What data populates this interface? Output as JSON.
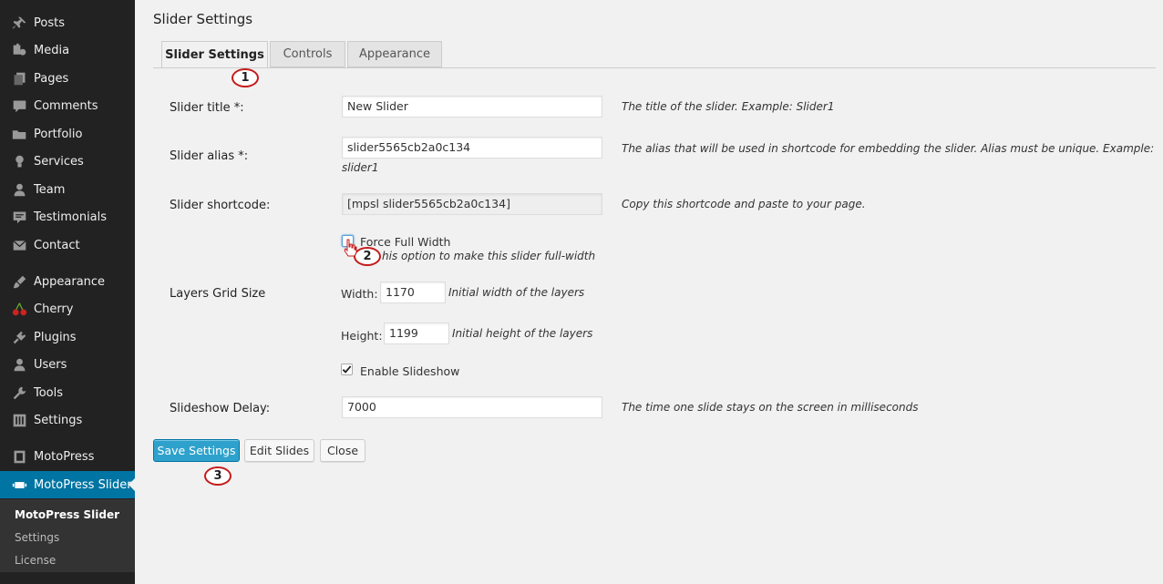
{
  "sidebar": {
    "items": [
      {
        "label": "Posts",
        "icon": "pin-icon"
      },
      {
        "label": "Media",
        "icon": "media-icon"
      },
      {
        "label": "Pages",
        "icon": "pages-icon"
      },
      {
        "label": "Comments",
        "icon": "comment-icon"
      },
      {
        "label": "Portfolio",
        "icon": "folder-icon"
      },
      {
        "label": "Services",
        "icon": "lightbulb-icon"
      },
      {
        "label": "Team",
        "icon": "person-icon"
      },
      {
        "label": "Testimonials",
        "icon": "testimonial-icon"
      },
      {
        "label": "Contact",
        "icon": "envelope-icon"
      },
      {
        "label": "Appearance",
        "icon": "paintbrush-icon"
      },
      {
        "label": "Cherry",
        "icon": "cherry-icon"
      },
      {
        "label": "Plugins",
        "icon": "plug-icon"
      },
      {
        "label": "Users",
        "icon": "users-icon"
      },
      {
        "label": "Tools",
        "icon": "wrench-icon"
      },
      {
        "label": "Settings",
        "icon": "settings-icon"
      },
      {
        "label": "MotoPress",
        "icon": "motopress-icon"
      },
      {
        "label": "MotoPress Slider",
        "icon": "slider-icon"
      }
    ],
    "submenu": [
      "MotoPress Slider",
      "Settings",
      "License"
    ]
  },
  "page_title": "Slider Settings",
  "tabs": [
    "Slider Settings",
    "Controls",
    "Appearance"
  ],
  "form": {
    "title_label": "Slider title *:",
    "title_value": "New Slider",
    "title_desc": "The title of the slider. Example: Slider1",
    "alias_label": "Slider alias *:",
    "alias_value": "slider5565cb2a0c134",
    "alias_desc": "The alias that will be used in shortcode for embedding the slider. Alias must be unique. Example:",
    "alias_desc_cont": "slider1",
    "shortcode_label": "Slider shortcode:",
    "shortcode_value": "[mpsl slider5565cb2a0c134]",
    "shortcode_desc": "Copy this shortcode and paste to your page.",
    "fullwidth_label": "Force Full Width",
    "fullwidth_checked": false,
    "fullwidth_desc": "his option to make this slider full-width",
    "grid_label": "Layers Grid Size",
    "width_label": "Width:",
    "width_value": "1170",
    "width_desc": "Initial width of the layers",
    "height_label": "Height:",
    "height_value": "1199",
    "height_desc": "Initial height of the layers",
    "slideshow_label": "Enable Slideshow",
    "slideshow_checked": true,
    "delay_label": "Slideshow Delay:",
    "delay_value": "7000",
    "delay_desc": "The time one slide stays on the screen in milliseconds"
  },
  "buttons": {
    "save": "Save Settings",
    "edit": "Edit Slides",
    "close": "Close"
  },
  "markers": [
    "1",
    "2",
    "3"
  ],
  "colors": {
    "sidebar_bg": "#222222",
    "accent": "#0074a2",
    "primary_button": "#2ea2cc",
    "marker_ring": "#c51b1b"
  }
}
